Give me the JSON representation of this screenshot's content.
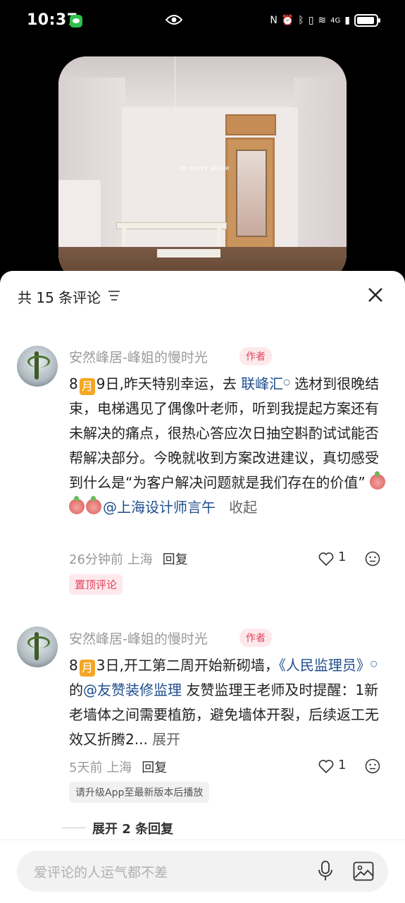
{
  "status_bar": {
    "time": "10:37",
    "network": "4G",
    "icons": [
      "wechat-icon",
      "eye-icon",
      "nfc-icon",
      "alarm-icon",
      "bluetooth-icon",
      "vibrate-icon",
      "wifi-icon",
      "signal-icon",
      "battery-icon"
    ]
  },
  "photo": {
    "watermark": "in every place"
  },
  "sheet": {
    "title": "共 15 条评论",
    "close_icon": "close-icon",
    "sort_icon": "sort-icon"
  },
  "comments": [
    {
      "name": "安然峰居-峰姐的慢时光",
      "tag": "作者",
      "text_month_pre": "8",
      "text_month": "月",
      "text_1": "9日,昨天特别幸运，去 ",
      "link_1": "联峰汇",
      "text_2": " 选材到很晚结束，电梯遇见了偶像叶老师，听到我提起方案还有未解决的痛点，很热心答应次日抽空斟酌试试能否帮解决部分。今晚就收到方案改进建议，真切感受到什么是“为客户解决问题就是我们存在的价值” ",
      "mention": "@上海设计师言午",
      "collapse": "收起",
      "time": "26分钟前",
      "location": "上海",
      "reply": "回复",
      "likes": "1",
      "pin": "置顶评论"
    },
    {
      "name": "安然峰居-峰姐的慢时光",
      "tag": "作者",
      "text_month_pre": "8",
      "text_month": "月",
      "text_1": "3日,开工第二周开始新砌墙，",
      "link_1": "《人民监理员》",
      "text_2": "的",
      "mention": "@友赞装修监理",
      "text_3": " 友赞监理王老师及时提醒：1新老墙体之间需要植筋，避免墙体开裂，后续返工无效又折腾2...",
      "expand": "展开",
      "time": "5天前",
      "location": "上海",
      "reply": "回复",
      "likes": "1",
      "upgrade": "请升级App至最新版本后播放",
      "expand_replies": "展开 2 条回复"
    }
  ],
  "input": {
    "placeholder": "爱评论的人运气都不差"
  }
}
